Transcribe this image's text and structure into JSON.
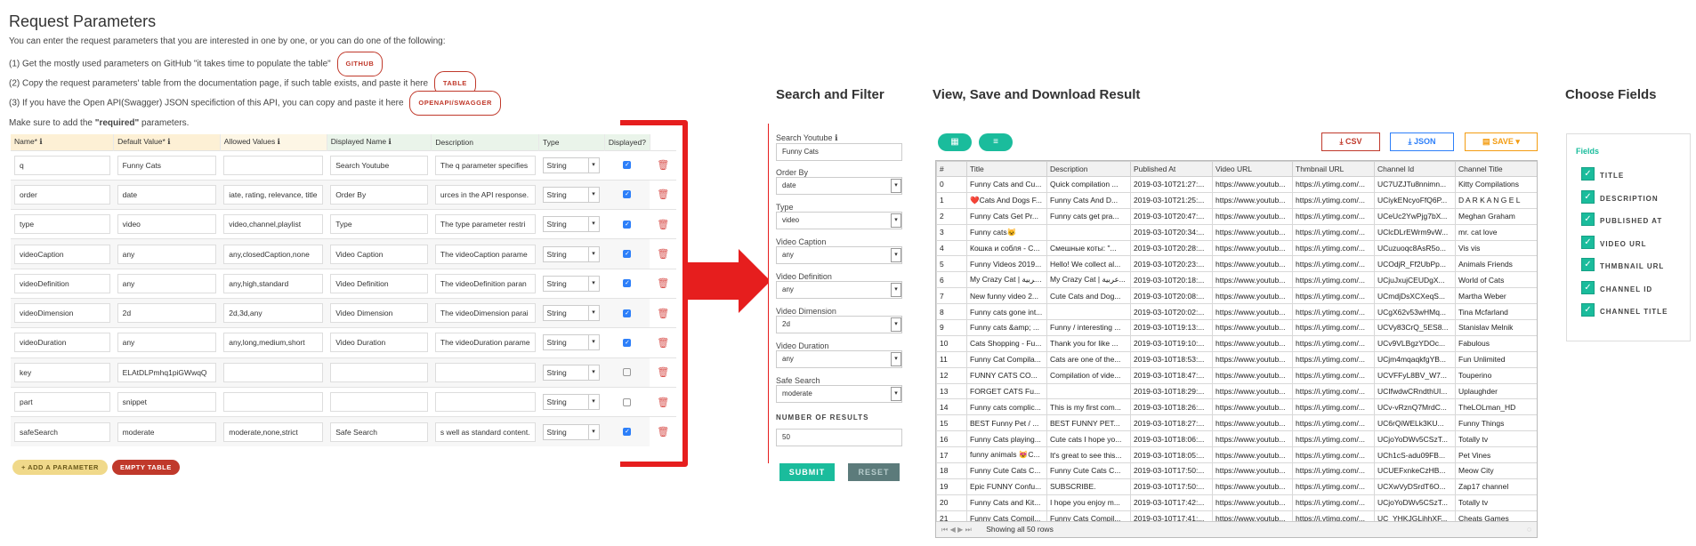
{
  "request": {
    "title": "Request Parameters",
    "intro": "You can enter the request parameters that you are interested in one by one, or you can do one of the following:",
    "step1": "(1) Get the mostly used parameters on GitHub \"it takes time to populate the table\"",
    "step1_btn": "GITHUB",
    "step2": "(2) Copy the request parameters' table from the documentation page, if such table exists, and paste it here",
    "step2_btn": "TABLE",
    "step3": "(3) If you have the Open API(Swagger) JSON specifiction of this API, you can copy and paste it here",
    "step3_btn": "OPENAPI/SWAGGER",
    "required_pre": "Make sure to add the ",
    "required_bold": "\"required\"",
    "required_post": " parameters.",
    "headers": [
      "Name*",
      "Default Value*",
      "Allowed Values",
      "Displayed Name",
      "Description",
      "Type",
      "Displayed?"
    ],
    "rows": [
      {
        "name": "q",
        "default": "Funny Cats",
        "allowed": "",
        "displayed": "Search Youtube",
        "desc": "The q parameter specifies",
        "type": "String",
        "checked": true
      },
      {
        "name": "order",
        "default": "date",
        "allowed": "iate, rating, relevance, title",
        "displayed": "Order By",
        "desc": "urces in the API response.",
        "type": "String",
        "checked": true
      },
      {
        "name": "type",
        "default": "video",
        "allowed": "video,channel,playlist",
        "displayed": "Type",
        "desc": "The type parameter restri",
        "type": "String",
        "checked": true
      },
      {
        "name": "videoCaption",
        "default": "any",
        "allowed": "any,closedCaption,none",
        "displayed": "Video Caption",
        "desc": "The videoCaption parame",
        "type": "String",
        "checked": true
      },
      {
        "name": "videoDefinition",
        "default": "any",
        "allowed": "any,high,standard",
        "displayed": "Video Definition",
        "desc": "The videoDefinition paran",
        "type": "String",
        "checked": true
      },
      {
        "name": "videoDimension",
        "default": "2d",
        "allowed": "2d,3d,any",
        "displayed": "Video Dimension",
        "desc": "The videoDimension parai",
        "type": "String",
        "checked": true
      },
      {
        "name": "videoDuration",
        "default": "any",
        "allowed": "any,long,medium,short",
        "displayed": "Video Duration",
        "desc": "The videoDuration parame",
        "type": "String",
        "checked": true
      },
      {
        "name": "key",
        "default": "ELAtDLPmhq1piGWwqQ",
        "allowed": "",
        "displayed": "",
        "desc": "",
        "type": "String",
        "checked": false
      },
      {
        "name": "part",
        "default": "snippet",
        "allowed": "",
        "displayed": "",
        "desc": "",
        "type": "String",
        "checked": false
      },
      {
        "name": "safeSearch",
        "default": "moderate",
        "allowed": "moderate,none,strict",
        "displayed": "Safe Search",
        "desc": "s well as standard content.",
        "type": "String",
        "checked": true
      }
    ],
    "add_btn": "+ ADD A PARAMETER",
    "empty_btn": "EMPTY TABLE"
  },
  "search": {
    "title": "Search and Filter",
    "fields": [
      {
        "label": "Search Youtube",
        "value": "Funny Cats",
        "kind": "input",
        "info": true
      },
      {
        "label": "Order By",
        "value": "date",
        "kind": "select"
      },
      {
        "label": "Type",
        "value": "video",
        "kind": "select"
      },
      {
        "label": "Video Caption",
        "value": "any",
        "kind": "select"
      },
      {
        "label": "Video Definition",
        "value": "any",
        "kind": "select"
      },
      {
        "label": "Video Dimension",
        "value": "2d",
        "kind": "select"
      },
      {
        "label": "Video Duration",
        "value": "any",
        "kind": "select"
      },
      {
        "label": "Safe Search",
        "value": "moderate",
        "kind": "select"
      }
    ],
    "results_label": "NUMBER OF RESULTS",
    "results_value": "50",
    "submit": "SUBMIT",
    "reset": "RESET"
  },
  "results": {
    "title": "View, Save and Download Result",
    "csv": "CSV",
    "json": "JSON",
    "save": "SAVE",
    "columns": [
      "#",
      "Title",
      "Description",
      "Published At",
      "Video URL",
      "Thmbnail URL",
      "Channel Id",
      "Channel Title"
    ],
    "rows": [
      [
        "0",
        "Funny Cats and Cu...",
        "Quick compilation ...",
        "2019-03-10T21:27:...",
        "https://www.youtub...",
        "https://i.ytimg.com/...",
        "UC7UZJTu8nnimn...",
        "Kitty Compilations"
      ],
      [
        "1",
        "❤️Cats And Dogs F...",
        "Funny Cats And D...",
        "2019-03-10T21:25:...",
        "https://www.youtub...",
        "https://i.ytimg.com/...",
        "UCiykENcyoFfQ6P...",
        "D A R K A N G E L"
      ],
      [
        "2",
        "Funny Cats Get Pr...",
        "Funny cats get pra...",
        "2019-03-10T20:47:...",
        "https://www.youtub...",
        "https://i.ytimg.com/...",
        "UCeUc2YwPjg7bX...",
        "Meghan Graham"
      ],
      [
        "3",
        "Funny cats😺",
        "",
        "2019-03-10T20:34:...",
        "https://www.youtub...",
        "https://i.ytimg.com/...",
        "UClcDLrEWrm9vW...",
        "mr. cat love"
      ],
      [
        "4",
        "Кошка и собля - С...",
        "Смешные коты: \"...",
        "2019-03-10T20:28:...",
        "https://www.youtub...",
        "https://i.ytimg.com/...",
        "UCuzuoqc8AsR5o...",
        "Vis vis"
      ],
      [
        "5",
        "Funny Videos 2019...",
        "Hello! We collect al...",
        "2019-03-10T20:23:...",
        "https://www.youtub...",
        "https://i.ytimg.com/...",
        "UCOdjR_Ff2UbPp...",
        "Animals Friends"
      ],
      [
        "6",
        "My Crazy Cat | عربية...",
        "My Crazy Cat | عربية...",
        "2019-03-10T20:18:...",
        "https://www.youtub...",
        "https://i.ytimg.com/...",
        "UCjuJxujCEUDgX...",
        "World of Cats"
      ],
      [
        "7",
        "New funny video 2...",
        "Cute Cats and Dog...",
        "2019-03-10T20:08:...",
        "https://www.youtub...",
        "https://i.ytimg.com/...",
        "UCmdjDsXCXeqS...",
        "Martha Weber"
      ],
      [
        "8",
        "Funny cats gone int...",
        "",
        "2019-03-10T20:02:...",
        "https://www.youtub...",
        "https://i.ytimg.com/...",
        "UCgX62v53wHMq...",
        "Tina Mcfarland"
      ],
      [
        "9",
        "Funny cats &amp; ...",
        "Funny / interesting ...",
        "2019-03-10T19:13:...",
        "https://www.youtub...",
        "https://i.ytimg.com/...",
        "UCVy83CrQ_5ES8...",
        "Stanislav Melnik"
      ],
      [
        "10",
        "Cats Shopping - Fu...",
        "Thank you for like ...",
        "2019-03-10T19:10:...",
        "https://www.youtub...",
        "https://i.ytimg.com/...",
        "UCv9VLBgzYDOc...",
        "Fabulous"
      ],
      [
        "11",
        "Funny Cat Compila...",
        "Cats are one of the...",
        "2019-03-10T18:53:...",
        "https://www.youtub...",
        "https://i.ytimg.com/...",
        "UCjm4mqaqkfgYB...",
        "Fun Unlimited"
      ],
      [
        "12",
        "FUNNY CATS CO...",
        "Compilation of vide...",
        "2019-03-10T18:47:...",
        "https://www.youtub...",
        "https://i.ytimg.com/...",
        "UCVFFyL8BV_W7...",
        "Touperino"
      ],
      [
        "13",
        "FORGET CATS Fu...",
        "",
        "2019-03-10T18:29:...",
        "https://www.youtub...",
        "https://i.ytimg.com/...",
        "UCIfwdwCRndthUI...",
        "Uplaughder"
      ],
      [
        "14",
        "Funny cats complic...",
        "This is my first com...",
        "2019-03-10T18:26:...",
        "https://www.youtub...",
        "https://i.ytimg.com/...",
        "UCv-vRznQ7MrdC...",
        "TheLOLman_HD"
      ],
      [
        "15",
        "BEST Funny Pet / ...",
        "BEST FUNNY PET...",
        "2019-03-10T18:27:...",
        "https://www.youtub...",
        "https://i.ytimg.com/...",
        "UC6rQiWELk3KU...",
        "Funny Things"
      ],
      [
        "16",
        "Funny Cats playing...",
        "Cute cats I hope yo...",
        "2019-03-10T18:06:...",
        "https://www.youtub...",
        "https://i.ytimg.com/...",
        "UCjoYoDWv5CSzT...",
        "Totally tv"
      ],
      [
        "17",
        "funny animals 😻C...",
        "It's great to see this...",
        "2019-03-10T18:05:...",
        "https://www.youtub...",
        "https://i.ytimg.com/...",
        "UCh1cS-adu09FB...",
        "Pet Vines"
      ],
      [
        "18",
        "Funny Cute Cats C...",
        "Funny Cute Cats C...",
        "2019-03-10T17:50:...",
        "https://www.youtub...",
        "https://i.ytimg.com/...",
        "UCUEFxnkeCzHB...",
        "Meow City"
      ],
      [
        "19",
        "Epic FUNNY Confu...",
        "SUBSCRIBE.",
        "2019-03-10T17:50:...",
        "https://www.youtub...",
        "https://i.ytimg.com/...",
        "UCXwVyDSrdT6O...",
        "Zap17 channel"
      ],
      [
        "20",
        "Funny Cats and Kit...",
        "I hope you enjoy m...",
        "2019-03-10T17:42:...",
        "https://www.youtub...",
        "https://i.ytimg.com/...",
        "UCjoYoDWv5CSzT...",
        "Totally tv"
      ],
      [
        "21",
        "Funny Cats Compil...",
        "Funny Cats Compil...",
        "2019-03-10T17:41:...",
        "https://www.youtub...",
        "https://i.ytimg.com/...",
        "UC_YHKJGLihhXF...",
        "Cheats Games"
      ]
    ],
    "footer": "Showing all 50 rows"
  },
  "fields": {
    "title": "Choose Fields",
    "subtitle": "Fields",
    "items": [
      "TITLE",
      "DESCRIPTION",
      "PUBLISHED AT",
      "VIDEO URL",
      "THMBNAIL URL",
      "CHANNEL ID",
      "CHANNEL TITLE"
    ]
  },
  "colors": {
    "accent_red": "#c0392b",
    "teal": "#1abc9c",
    "blue": "#2d7ff9",
    "orange": "#f39c12",
    "arrow_red": "#e61e1e"
  },
  "icons": [
    "info-icon",
    "trash-icon",
    "grid-icon",
    "chart-icon",
    "download-icon",
    "check-icon",
    "arrow-right-icon"
  ]
}
